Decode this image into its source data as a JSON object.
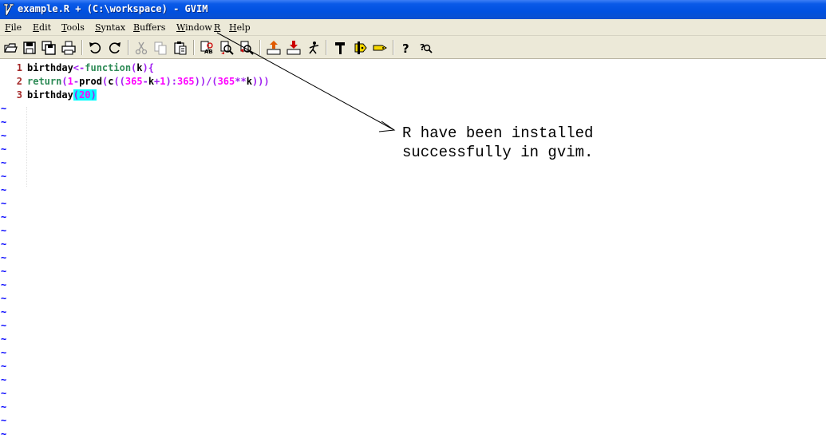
{
  "window": {
    "title": "example.R + (C:\\workspace) - GVIM"
  },
  "menu": {
    "items": [
      {
        "mnemonic": "F",
        "rest": "ile"
      },
      {
        "mnemonic": "E",
        "rest": "dit"
      },
      {
        "mnemonic": "T",
        "rest": "ools"
      },
      {
        "mnemonic": "S",
        "rest": "yntax"
      },
      {
        "mnemonic": "B",
        "rest": "uffers"
      },
      {
        "mnemonic": "W",
        "rest": "indow"
      },
      {
        "mnemonic": "R",
        "rest": ""
      },
      {
        "mnemonic": "H",
        "rest": "elp"
      }
    ]
  },
  "toolbar": {
    "icons": [
      "open-icon",
      "save-icon",
      "save-all-icon",
      "print-icon",
      "undo-icon",
      "redo-icon",
      "cut-icon",
      "copy-icon",
      "paste-icon",
      "find-replace-icon",
      "find-next-icon",
      "find-prev-icon",
      "load-session-icon",
      "save-session-icon",
      "run-script-icon",
      "make-icon",
      "build-tags-icon",
      "jump-tag-icon",
      "help-icon",
      "find-help-icon"
    ],
    "colors": {
      "background": "#ece9d8"
    }
  },
  "editor": {
    "lines": [
      {
        "num": "1"
      },
      {
        "num": "2"
      },
      {
        "num": "3"
      }
    ],
    "line1": {
      "a": "birthday",
      "b": "<-",
      "c": "function",
      "d": "(",
      "e": "k",
      "f": "){"
    },
    "line2": {
      "a": "return",
      "b": "(",
      "c": "1",
      "d": "-",
      "e": "prod",
      "f": "(",
      "g": "c",
      "h": "((",
      "i": "365",
      "j": "-",
      "k": "k",
      "l": "+",
      "m": "1",
      "n": "):",
      "o": "365",
      "p": "))/(",
      "q": "365",
      "r": "**",
      "s": "k",
      "t": ")))"
    },
    "line3": {
      "a": "birthday",
      "b": "(",
      "c": "20",
      "d": ")"
    },
    "tilde": "~",
    "colors": {
      "line_number": "#a52a2a",
      "keyword": "#2e8b57",
      "operator": "#a020f0",
      "number": "#ff00ff",
      "match_highlight": "#00ffff",
      "tilde": "#0000ff"
    }
  },
  "annotation": {
    "line1": "R have been installed",
    "line2": "successfully in gvim."
  }
}
